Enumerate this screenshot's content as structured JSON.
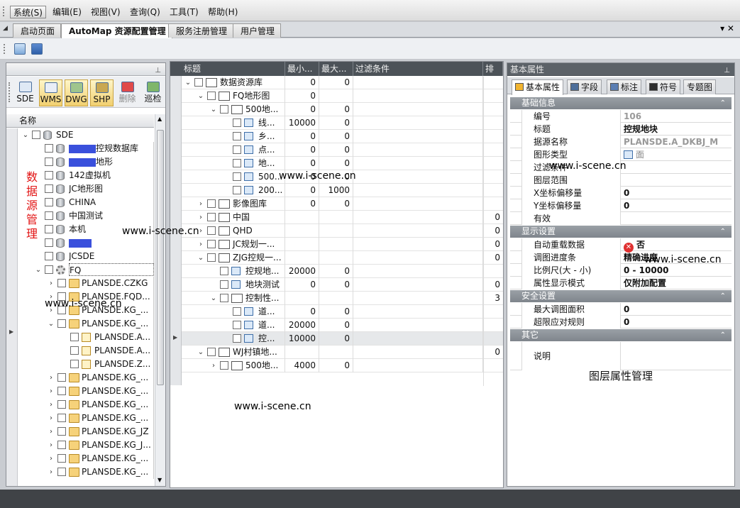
{
  "menu": [
    {
      "label": "系统(S)",
      "active": true
    },
    {
      "label": "编辑(E)"
    },
    {
      "label": "视图(V)"
    },
    {
      "label": "查询(Q)"
    },
    {
      "label": "工具(T)"
    },
    {
      "label": "帮助(H)"
    }
  ],
  "tabs": [
    {
      "label": "启动页面"
    },
    {
      "label": "AutoMap 资源配置管理",
      "selected": true
    },
    {
      "label": "服务注册管理"
    },
    {
      "label": "用户管理"
    }
  ],
  "tab_controls": "▾ ✕",
  "left": {
    "tools": [
      {
        "label": "SDE",
        "on": false
      },
      {
        "label": "WMS",
        "on": true
      },
      {
        "label": "DWG",
        "on": true
      },
      {
        "label": "SHP",
        "on": true
      },
      {
        "label": "删除",
        "on": false
      },
      {
        "label": "巡检",
        "on": false
      }
    ],
    "column": "名称",
    "side_text": "数据源管理",
    "tree": [
      {
        "label": "SDE",
        "arrow": "⌄",
        "icon": "db"
      },
      {
        "label": "控规数据库",
        "icon": "db",
        "redact": true
      },
      {
        "label": "地形",
        "icon": "db",
        "redact": true
      },
      {
        "label": "142虚拟机",
        "icon": "db"
      },
      {
        "label": "JC地形图",
        "icon": "db"
      },
      {
        "label": "CHINA",
        "icon": "db"
      },
      {
        "label": "中国测试",
        "icon": "db"
      },
      {
        "label": "本机",
        "icon": "db"
      },
      {
        "label": "",
        "icon": "db",
        "redact": true
      },
      {
        "label": "JCSDE",
        "icon": "db"
      },
      {
        "label": "FQ",
        "arrow": "⌄",
        "icon": "gear"
      },
      {
        "label": "PLANSDE.CZKG",
        "arrow": "›",
        "icon": "fold"
      },
      {
        "label": "PLANSDE.FQD...",
        "arrow": "›",
        "icon": "fold"
      },
      {
        "label": "PLANSDE.KG_...",
        "arrow": "›",
        "icon": "fold"
      },
      {
        "label": "PLANSDE.KG_...",
        "arrow": "⌄",
        "icon": "fold"
      },
      {
        "label": "PLANSDE.A...",
        "icon": "lay"
      },
      {
        "label": "PLANSDE.A...",
        "icon": "lay"
      },
      {
        "label": "PLANSDE.Z...",
        "icon": "lay"
      },
      {
        "label": "PLANSDE.KG_...",
        "arrow": "›",
        "icon": "fold"
      },
      {
        "label": "PLANSDE.KG_...",
        "arrow": "›",
        "icon": "fold"
      },
      {
        "label": "PLANSDE.KG_...",
        "arrow": "›",
        "icon": "fold"
      },
      {
        "label": "PLANSDE.KG_...",
        "arrow": "›",
        "icon": "fold"
      },
      {
        "label": "PLANSDE.KG_JZ",
        "arrow": "›",
        "icon": "fold"
      },
      {
        "label": "PLANSDE.KG_J...",
        "arrow": "›",
        "icon": "fold"
      },
      {
        "label": "PLANSDE.KG_...",
        "arrow": "›",
        "icon": "fold"
      },
      {
        "label": "PLANSDE.KG_...",
        "arrow": "›",
        "icon": "fold"
      },
      {
        "label": "PLANSDE.KG_...",
        "arrow": "›",
        "icon": "fold"
      }
    ]
  },
  "middle": {
    "columns": [
      "标题",
      "最小...",
      "最大...",
      "过滤条件",
      "排"
    ],
    "rows": [
      {
        "title": "数据资源库",
        "arrow": "⌄",
        "icon": "grp",
        "min": "0",
        "max": "0",
        "extra": ""
      },
      {
        "title": "FQ地形图",
        "arrow": "⌄",
        "icon": "grp",
        "min": "0",
        "max": "",
        "extra": ""
      },
      {
        "title": "500地...",
        "arrow": "⌄",
        "icon": "grp",
        "min": "0",
        "max": "0",
        "extra": ""
      },
      {
        "title": "线...",
        "icon": "row",
        "min": "10000",
        "max": "0",
        "extra": ""
      },
      {
        "title": "乡...",
        "icon": "row",
        "min": "0",
        "max": "0",
        "extra": ""
      },
      {
        "title": "点...",
        "icon": "row",
        "min": "0",
        "max": "0",
        "extra": ""
      },
      {
        "title": "地...",
        "icon": "row",
        "min": "0",
        "max": "0",
        "extra": ""
      },
      {
        "title": "500...",
        "icon": "row",
        "min": "0",
        "max": "0",
        "extra": ""
      },
      {
        "title": "200...",
        "icon": "row",
        "min": "0",
        "max": "1000",
        "extra": ""
      },
      {
        "title": "影像图库",
        "arrow": "›",
        "icon": "grp",
        "min": "0",
        "max": "0",
        "extra": ""
      },
      {
        "title": "中国",
        "arrow": "›",
        "icon": "grp",
        "min": "",
        "max": "",
        "extra": "0"
      },
      {
        "title": "QHD",
        "arrow": "›",
        "icon": "grp",
        "min": "",
        "max": "",
        "extra": "0"
      },
      {
        "title": "JC规划一...",
        "arrow": "›",
        "icon": "grp",
        "min": "",
        "max": "",
        "extra": "0"
      },
      {
        "title": "ZJG控规一...",
        "arrow": "⌄",
        "icon": "grp",
        "min": "",
        "max": "",
        "extra": "0"
      },
      {
        "title": "控规地...",
        "icon": "row",
        "min": "20000",
        "max": "0",
        "extra": ""
      },
      {
        "title": "地块测试",
        "icon": "row",
        "min": "0",
        "max": "0",
        "extra": "0"
      },
      {
        "title": "控制性...",
        "arrow": "⌄",
        "icon": "grp",
        "min": "",
        "max": "",
        "extra": "3"
      },
      {
        "title": "道...",
        "icon": "row",
        "min": "0",
        "max": "0",
        "extra": ""
      },
      {
        "title": "道...",
        "icon": "row",
        "min": "20000",
        "max": "0",
        "extra": ""
      },
      {
        "title": "控...",
        "icon": "row",
        "min": "10000",
        "max": "0",
        "extra": "",
        "hl": true
      },
      {
        "title": "WJ村镇地...",
        "arrow": "⌄",
        "icon": "grp",
        "min": "",
        "max": "",
        "extra": "0"
      },
      {
        "title": "500地...",
        "arrow": "›",
        "icon": "grp",
        "min": "4000",
        "max": "0",
        "extra": ""
      }
    ]
  },
  "right": {
    "title": "基本属性",
    "tabs": [
      {
        "label": "基本属性",
        "selected": true
      },
      {
        "label": "字段"
      },
      {
        "label": "标注"
      },
      {
        "label": "符号"
      },
      {
        "label": "专题图"
      }
    ],
    "sections": [
      {
        "title": "基础信息",
        "rows": [
          {
            "k": "编号",
            "v": "106",
            "style": "gray"
          },
          {
            "k": "标题",
            "v": "控规地块"
          },
          {
            "k": "据源名称",
            "v": "PLANSDE.A_DKBJ_M",
            "style": "gray"
          },
          {
            "k": "图形类型",
            "v": "面",
            "style": "norm"
          },
          {
            "k": "过滤条件",
            "v": ""
          },
          {
            "k": "图层范围",
            "v": ""
          },
          {
            "k": "X坐标偏移量",
            "v": "0"
          },
          {
            "k": "Y坐标偏移量",
            "v": "0"
          },
          {
            "k": "有效",
            "v": ""
          }
        ]
      },
      {
        "title": "显示设置",
        "rows": [
          {
            "k": "自动重载数据",
            "v": "否",
            "x": true
          },
          {
            "k": "调图进度条",
            "v": "精确进度"
          },
          {
            "k": "比例尺(大 - 小)",
            "v": "0             -  10000"
          },
          {
            "k": "属性显示模式",
            "v": "仅附加配置"
          }
        ]
      },
      {
        "title": "安全设置",
        "rows": [
          {
            "k": "最大调图面积",
            "v": "0"
          },
          {
            "k": "超限应对规则",
            "v": "0"
          }
        ]
      },
      {
        "title": "其它",
        "rows": [
          {
            "k": "说明",
            "v": ""
          }
        ]
      }
    ],
    "caption": "图层属性管理"
  },
  "watermark": "www.i-scene.cn",
  "colors": {
    "accent": "#f1cf6f",
    "header_dark": "#4c5258",
    "section": "#8a9096",
    "redact": "#3a50dc",
    "side_text": "#e21212"
  }
}
